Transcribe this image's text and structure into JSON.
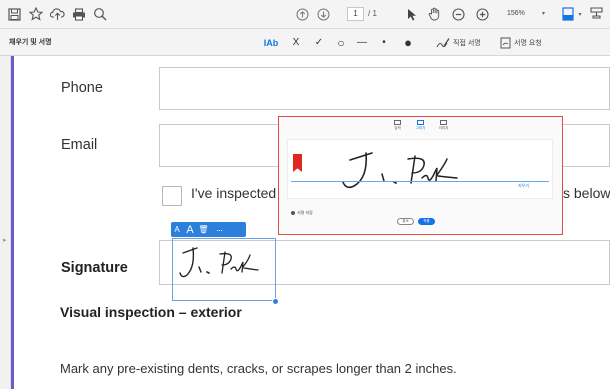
{
  "toolbar": {
    "icons": [
      "save-icon",
      "star-icon",
      "upload-icon",
      "print-icon",
      "zoom-search-icon",
      "page-up-icon",
      "page-down-icon",
      "select-cursor-icon",
      "hand-icon",
      "zoom-out-icon",
      "zoom-in-icon",
      "page-fit-icon",
      "stamp-icon"
    ],
    "page_current": "1",
    "page_of": "/ 1",
    "zoom": "156%",
    "zoom_dropdown": "▾",
    "fit_dropdown": "▾"
  },
  "fill_sign": {
    "title": "채우기 및 서명",
    "text_tool": "IAb",
    "cross_tool": "X",
    "check_tool": "✓",
    "ellipse_tool": "○",
    "line_tool": "—",
    "dot_small_tool": "•",
    "dot_large_tool": "●",
    "self_sign_label": "직접 서명",
    "request_sign_label": "서명 요청"
  },
  "form": {
    "phone_label": "Phone",
    "email_label": "Email",
    "checkbox_text": "I've inspected",
    "checkbox_tail": "s below",
    "signature_label": "Signature",
    "section_title": "Visual inspection – exterior",
    "section_text": "Mark any pre-existing dents, cracks, or scrapes longer than 2 inches."
  },
  "selection_toolbar": {
    "smaller_text": "A",
    "larger_text": "A",
    "delete": "🗑",
    "more": "···"
  },
  "popup": {
    "tabs": [
      "입력",
      "그리기",
      "이미지"
    ],
    "active_tab": 1,
    "clear_label": "지우기",
    "save_label": "서명 저장",
    "cancel_label": "취소",
    "apply_label": "적용"
  },
  "colors": {
    "accent": "#1473e6",
    "popup_border": "#e34a4a",
    "flag": "#e0281e",
    "rail_accent": "#6b5bd1"
  }
}
